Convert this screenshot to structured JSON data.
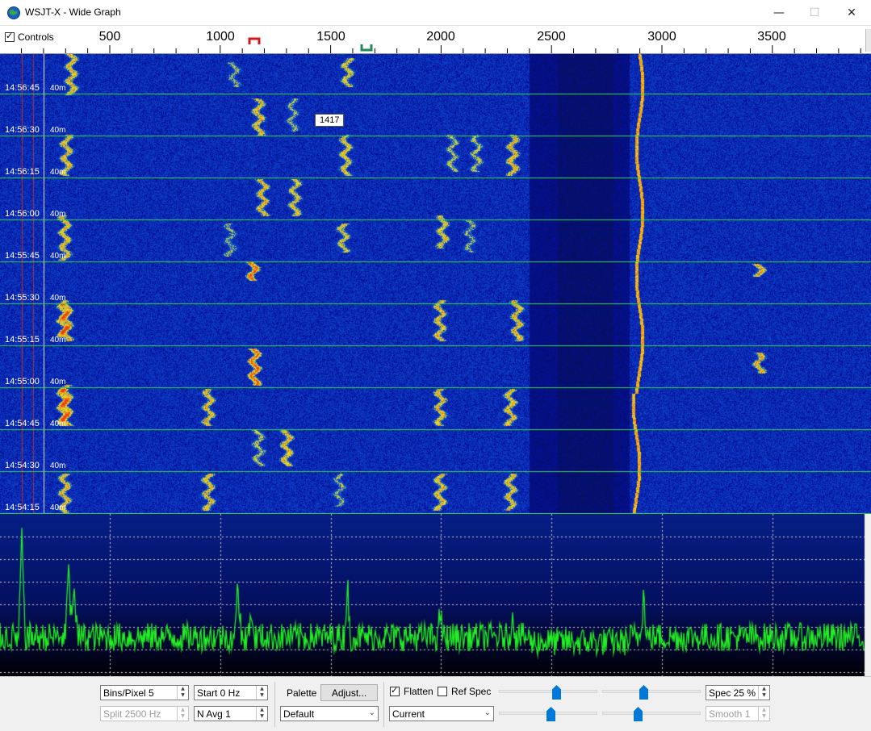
{
  "window": {
    "title": "WSJT-X - Wide Graph",
    "minimize_glyph": "—",
    "maximize_glyph": "☐",
    "close_glyph": "✕"
  },
  "scale": {
    "controls_label": "Controls",
    "controls_checked": true,
    "freq_labels": [
      "500",
      "1000",
      "1500",
      "2000",
      "2500",
      "3000",
      "3500"
    ],
    "rx_marker_color": "#d7191c",
    "tx_marker_color": "#1e8a55"
  },
  "waterfall": {
    "tooltip": "1417",
    "rows": [
      {
        "time": "14:56:45",
        "band": "40m"
      },
      {
        "time": "14:56:30",
        "band": "40m"
      },
      {
        "time": "14:56:15",
        "band": "40m"
      },
      {
        "time": "14:56:00",
        "band": "40m"
      },
      {
        "time": "14:55:45",
        "band": "40m"
      },
      {
        "time": "14:55:30",
        "band": "40m"
      },
      {
        "time": "14:55:15",
        "band": "40m"
      },
      {
        "time": "14:55:00",
        "band": "40m"
      },
      {
        "time": "14:54:45",
        "band": "40m"
      },
      {
        "time": "14:54:30",
        "band": "40m"
      },
      {
        "time": "14:54:15",
        "band": "40m"
      }
    ],
    "separator_color": "#3cd34a",
    "background_color": "#0b1e8a"
  },
  "spectrum": {
    "trace_color": "#22ee22",
    "grid_color": "#d0d0d0"
  },
  "controls": {
    "bins_per_pixel": "Bins/Pixel  5",
    "start": "Start 0 Hz",
    "split": "Split  2500  Hz",
    "n_avg": "N Avg 1",
    "palette_label": "Palette",
    "adjust_button": "Adjust...",
    "palette_value": "Default",
    "flatten_label": "Flatten",
    "flatten_checked": true,
    "ref_spec_label": "Ref Spec",
    "ref_spec_checked": false,
    "spectrum_mode": "Current",
    "spec": "Spec 25 %",
    "smooth": "Smooth  1"
  }
}
